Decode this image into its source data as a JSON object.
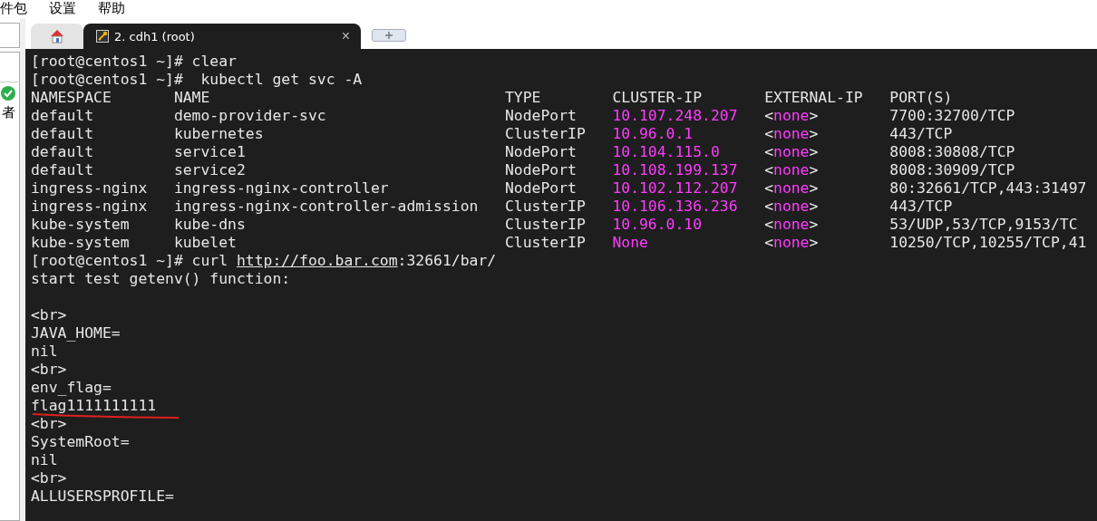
{
  "menu_bar": {
    "items": [
      "件包",
      "设置",
      "帮助"
    ]
  },
  "side_panel": {
    "label": "者"
  },
  "tabs": [
    {
      "kind": "home",
      "selected": false
    },
    {
      "kind": "session",
      "label": "2. cdh1 (root)",
      "selected": true,
      "close": "×"
    },
    {
      "kind": "new"
    }
  ],
  "terminal": {
    "lines": [
      {
        "kind": "text",
        "text": "[root@centos1 ~]# clear"
      },
      {
        "kind": "text",
        "text": "[root@centos1 ~]#  kubectl get svc -A"
      },
      {
        "kind": "header",
        "cells": [
          "NAMESPACE",
          "NAME",
          "TYPE",
          "CLUSTER-IP",
          "EXTERNAL-IP",
          "PORT(S)"
        ]
      },
      {
        "kind": "row",
        "cells": [
          "default",
          "demo-provider-svc",
          "NodePort",
          "10.107.248.207",
          "<none>",
          "7700:32700/TCP"
        ]
      },
      {
        "kind": "row",
        "cells": [
          "default",
          "kubernetes",
          "ClusterIP",
          "10.96.0.1",
          "<none>",
          "443/TCP"
        ]
      },
      {
        "kind": "row",
        "cells": [
          "default",
          "service1",
          "NodePort",
          "10.104.115.0",
          "<none>",
          "8008:30808/TCP"
        ]
      },
      {
        "kind": "row",
        "cells": [
          "default",
          "service2",
          "NodePort",
          "10.108.199.137",
          "<none>",
          "8008:30909/TCP"
        ]
      },
      {
        "kind": "row",
        "cells": [
          "ingress-nginx",
          "ingress-nginx-controller",
          "NodePort",
          "10.102.112.207",
          "<none>",
          "80:32661/TCP,443:31497"
        ]
      },
      {
        "kind": "row",
        "cells": [
          "ingress-nginx",
          "ingress-nginx-controller-admission",
          "ClusterIP",
          "10.106.136.236",
          "<none>",
          "443/TCP"
        ]
      },
      {
        "kind": "row",
        "cells": [
          "kube-system",
          "kube-dns",
          "ClusterIP",
          "10.96.0.10",
          "<none>",
          "53/UDP,53/TCP,9153/TC"
        ]
      },
      {
        "kind": "row",
        "cells": [
          "kube-system",
          "kubelet",
          "ClusterIP",
          "None",
          "<none>",
          "10250/TCP,10255/TCP,41"
        ]
      },
      {
        "kind": "command",
        "prompt": "[root@centos1 ~]# curl ",
        "link": "http://foo.bar.com",
        "rest": ":32661/bar/"
      },
      {
        "kind": "text",
        "text": "start test getenv() function:"
      },
      {
        "kind": "blank"
      },
      {
        "kind": "text",
        "text": "<br>"
      },
      {
        "kind": "text",
        "text": "JAVA_HOME="
      },
      {
        "kind": "text",
        "text": "nil"
      },
      {
        "kind": "text",
        "text": "<br>"
      },
      {
        "kind": "text",
        "text": "env_flag="
      },
      {
        "kind": "text",
        "text": "flag1111111111",
        "underlined": true
      },
      {
        "kind": "text",
        "text": "<br>"
      },
      {
        "kind": "text",
        "text": "SystemRoot="
      },
      {
        "kind": "text",
        "text": "nil"
      },
      {
        "kind": "text",
        "text": "<br>"
      },
      {
        "kind": "text",
        "text": "ALLUSERSPROFILE="
      }
    ]
  }
}
